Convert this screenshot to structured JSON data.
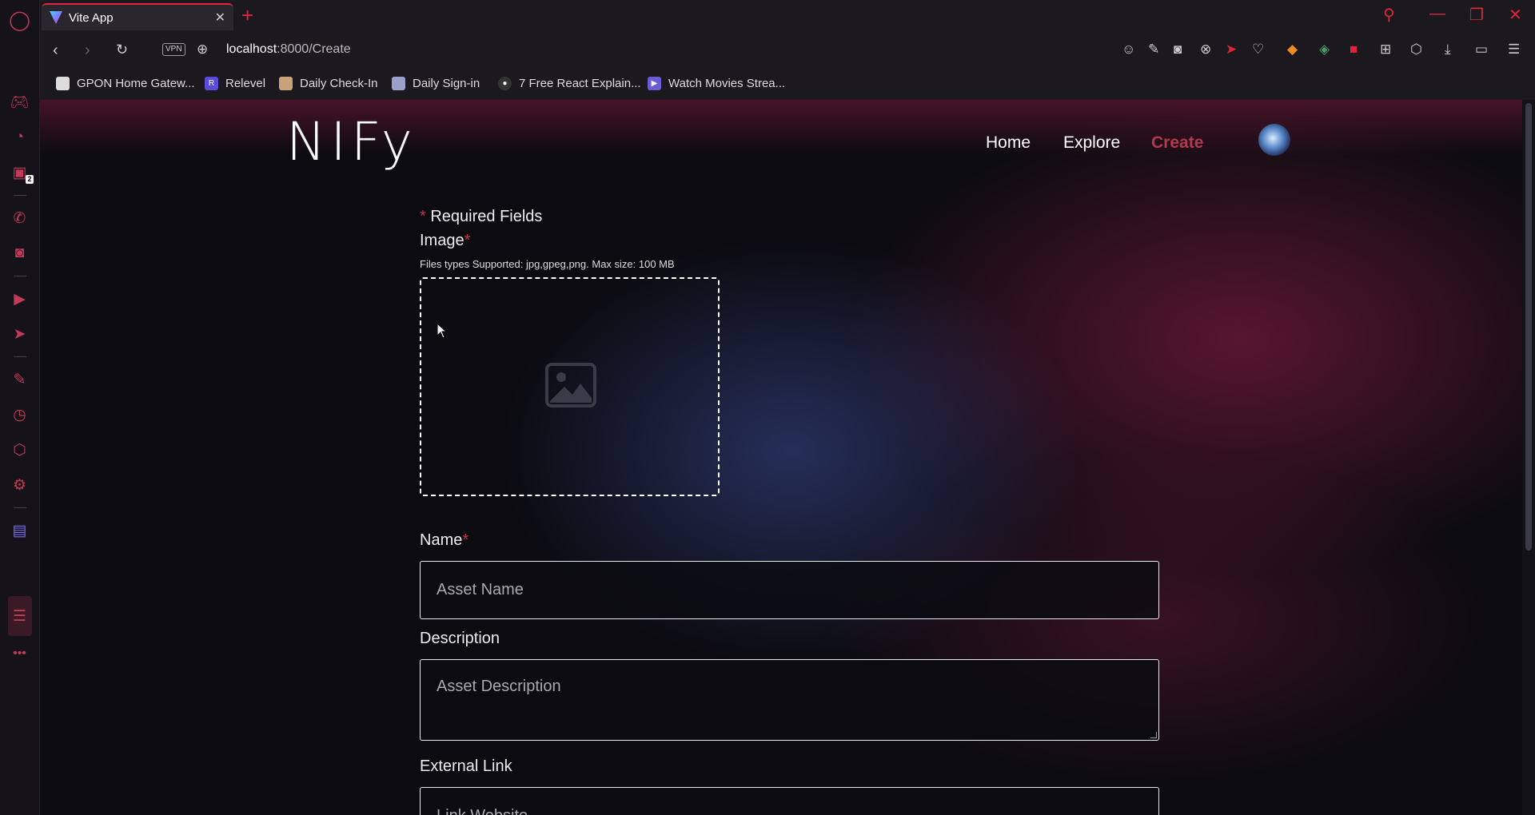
{
  "browser": {
    "tab_title": "Vite App",
    "url_host": "localhost",
    "url_path": ":8000/Create",
    "vpn_label": "VPN",
    "sidebar_badge": "2",
    "bookmarks": [
      {
        "label": "GPON Home Gatew...",
        "icon": "doc-icon",
        "color": "#dddddd"
      },
      {
        "label": "Relevel",
        "icon": "R",
        "color": "#5b4bdb"
      },
      {
        "label": "Daily Check-In",
        "icon": "anime-icon",
        "color": "#c9a27a"
      },
      {
        "label": "Daily Sign-in",
        "icon": "anime-icon",
        "color": "#9aa0c8"
      },
      {
        "label": "7 Free React Explain...",
        "icon": "github-icon",
        "color": "#333333"
      },
      {
        "label": "Watch Movies Strea...",
        "icon": "play-icon",
        "color": "#6b5cd6"
      }
    ]
  },
  "site": {
    "logo": "NIFy",
    "nav": [
      {
        "label": "Home"
      },
      {
        "label": "Explore"
      },
      {
        "label": "Create",
        "active": true
      }
    ]
  },
  "form": {
    "required_note": "Required Fields",
    "asterisk": "*",
    "image_label": "Image",
    "image_hint": "Files types Supported: jpg,gpeg,png. Max size: 100 MB",
    "name_label": "Name",
    "name_placeholder": "Asset Name",
    "description_label": "Description",
    "description_placeholder": "Asset Description",
    "link_label": "External Link",
    "link_placeholder": "Link Website"
  },
  "colors": {
    "accent": "#e0243d",
    "active_nav": "#b13a4c"
  }
}
